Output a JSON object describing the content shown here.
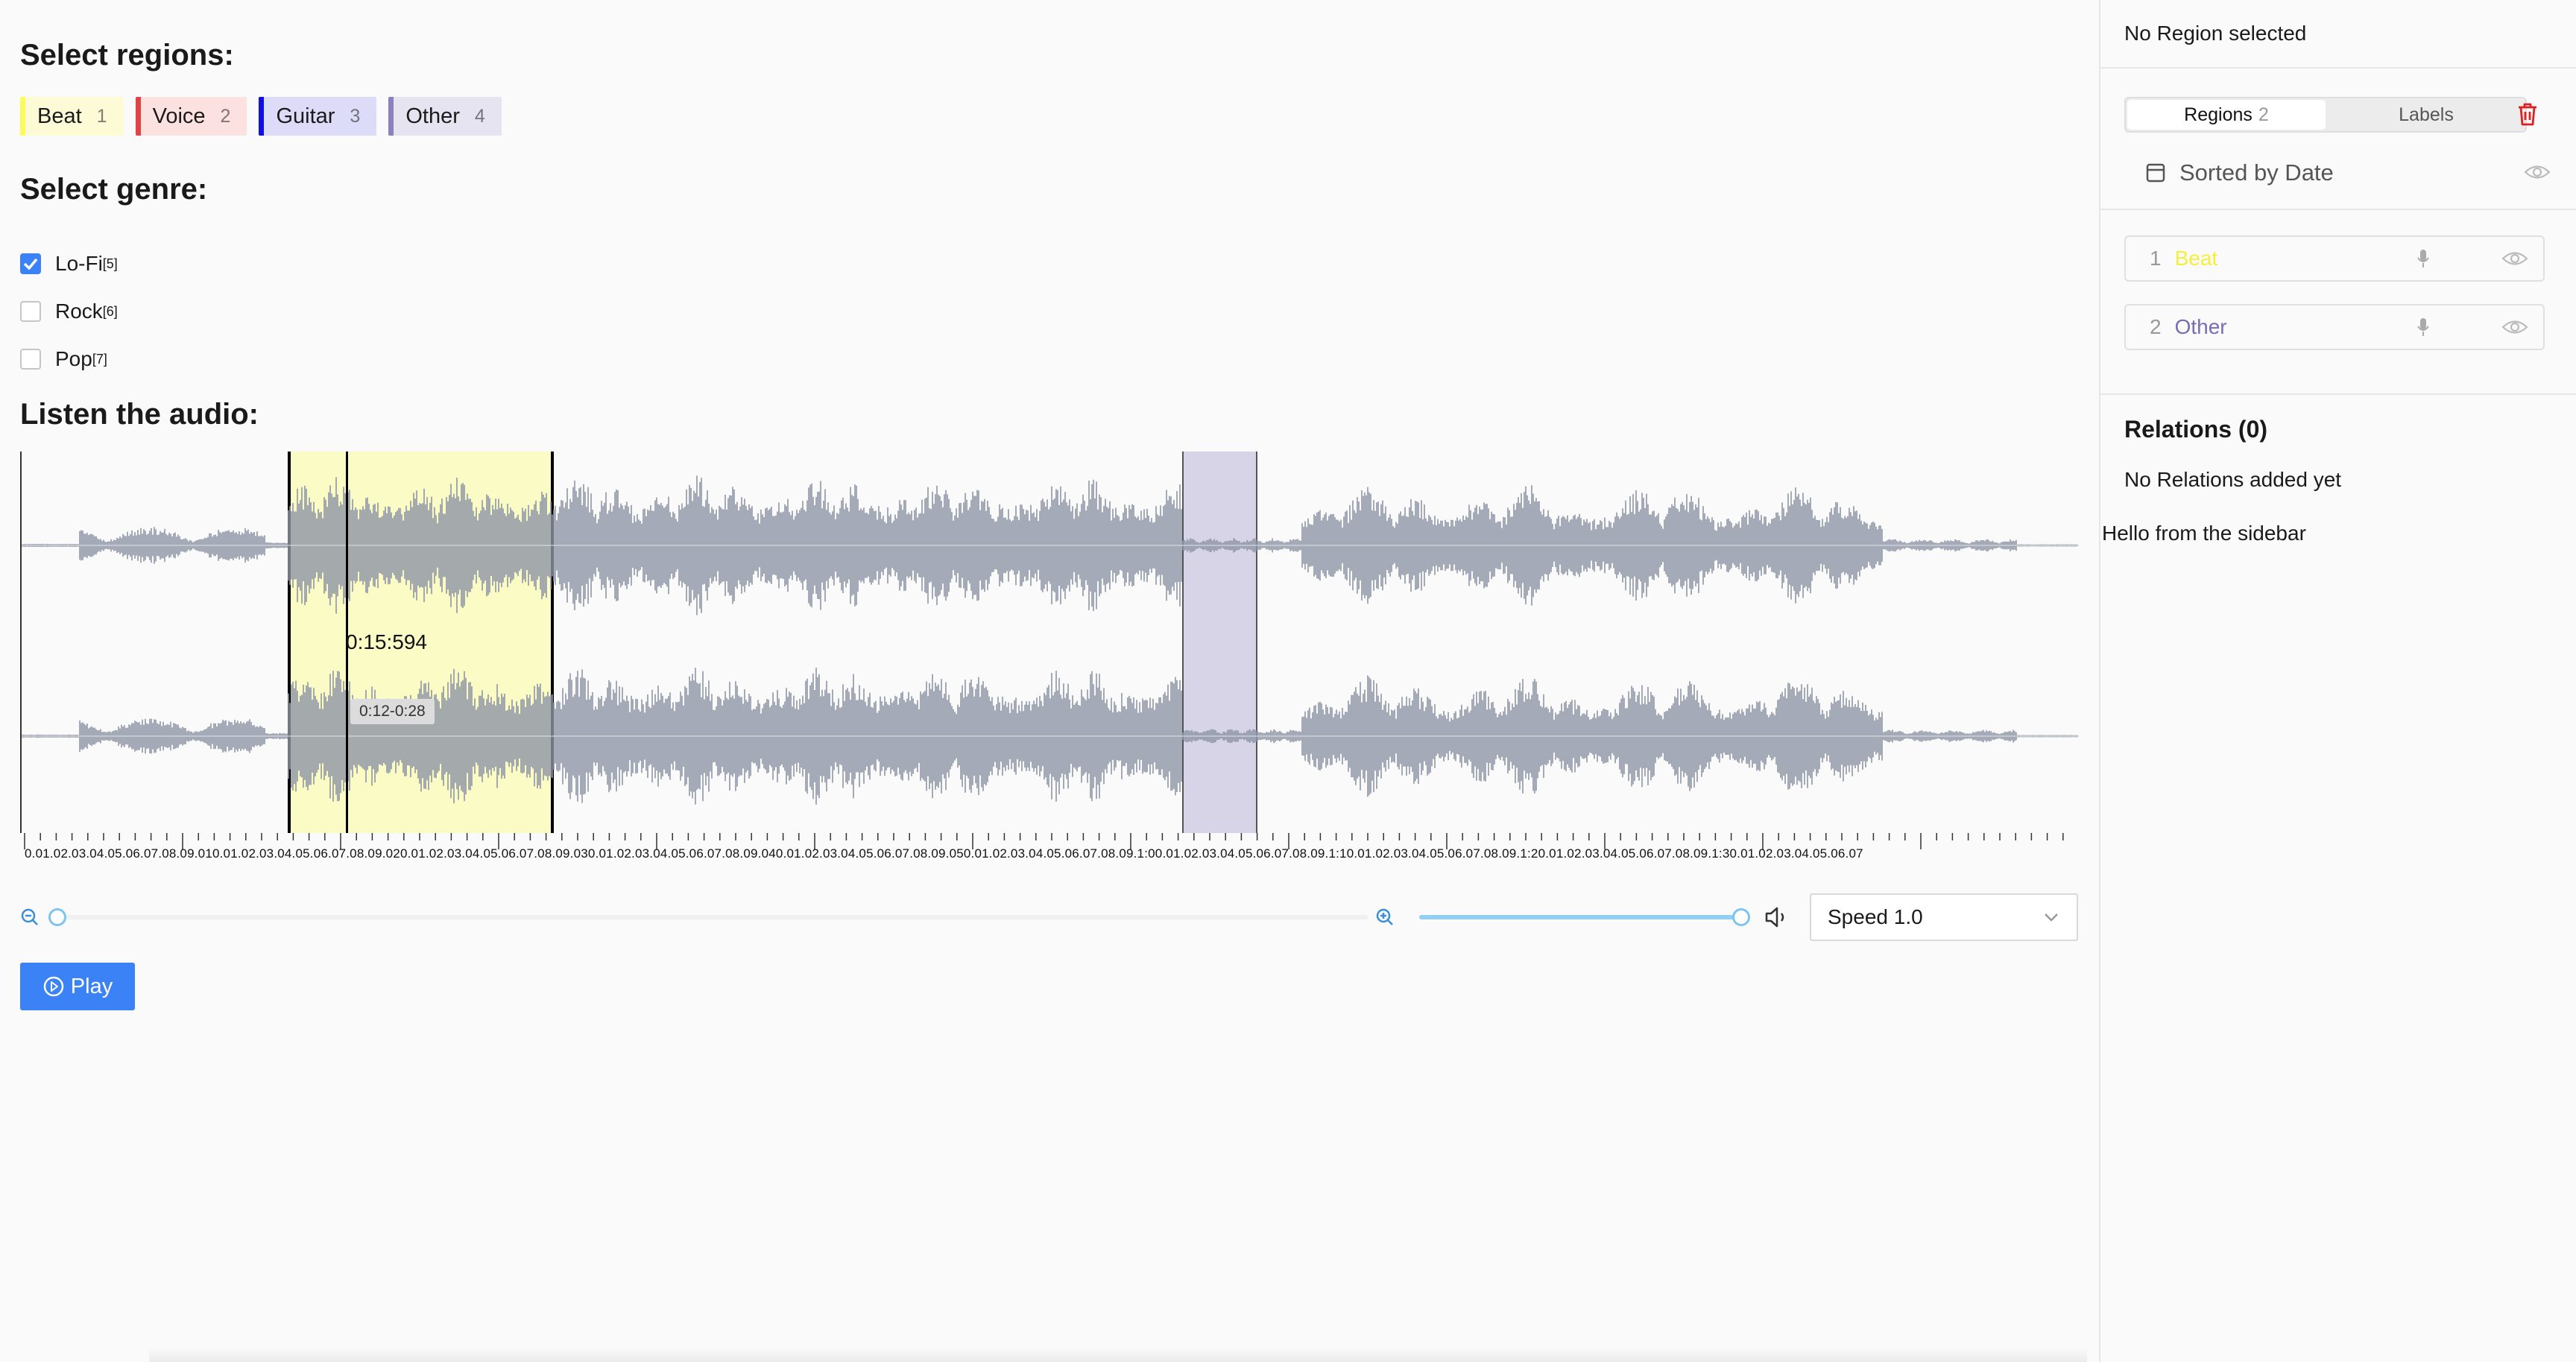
{
  "headings": {
    "regions": "Select regions:",
    "genre": "Select genre:",
    "audio": "Listen the audio:"
  },
  "regions": [
    {
      "label": "Beat",
      "key": "1",
      "color": "#fffa5c",
      "bg": "#fdfbd6"
    },
    {
      "label": "Voice",
      "key": "2",
      "color": "#e04444",
      "bg": "#fbe1e0"
    },
    {
      "label": "Guitar",
      "key": "3",
      "color": "#1010e0",
      "bg": "#dcdcf8"
    },
    {
      "label": "Other",
      "key": "4",
      "color": "#8c80c0",
      "bg": "#e6e4f0"
    }
  ],
  "genres": [
    {
      "label": "Lo-Fi",
      "key": "[5]",
      "checked": true
    },
    {
      "label": "Rock",
      "key": "[6]",
      "checked": false
    },
    {
      "label": "Pop",
      "key": "[7]",
      "checked": false
    }
  ],
  "player": {
    "cursor_time": "0:15:594",
    "region_tooltip": "0:12-0:28",
    "speed_label": "Speed 1.0",
    "play_label": "Play",
    "zoom_level": 0,
    "volume_level": 1.0,
    "timeline_ticks": "0.01.02.03.04.05.06.07.08.09.010.01.02.03.04.05.06.07.08.09.020.01.02.03.04.05.06.07.08.09.030.01.02.03.04.05.06.07.08.09.040.01.02.03.04.05.06.07.08.09.050.01.02.03.04.05.06.07.08.09.1:00.01.02.03.04.05.06.07.08.09.1:10.01.02.03.04.05.06.07.08.09.1:20.01.02.03.04.05.06.07.08.09.1:30.01.02.03.04.05.06.07"
  },
  "sidebar": {
    "header": "No Region selected",
    "tab_regions": "Regions",
    "tab_regions_count": "2",
    "tab_labels": "Labels",
    "sort_label": "Sorted by Date",
    "items": [
      {
        "num": "1",
        "label": "Beat",
        "color": "#f5ef3c"
      },
      {
        "num": "2",
        "label": "Other",
        "color": "#7a6cb4"
      }
    ],
    "relations_title": "Relations (0)",
    "relations_empty": "No Relations added yet",
    "hello": "Hello from the sidebar"
  }
}
